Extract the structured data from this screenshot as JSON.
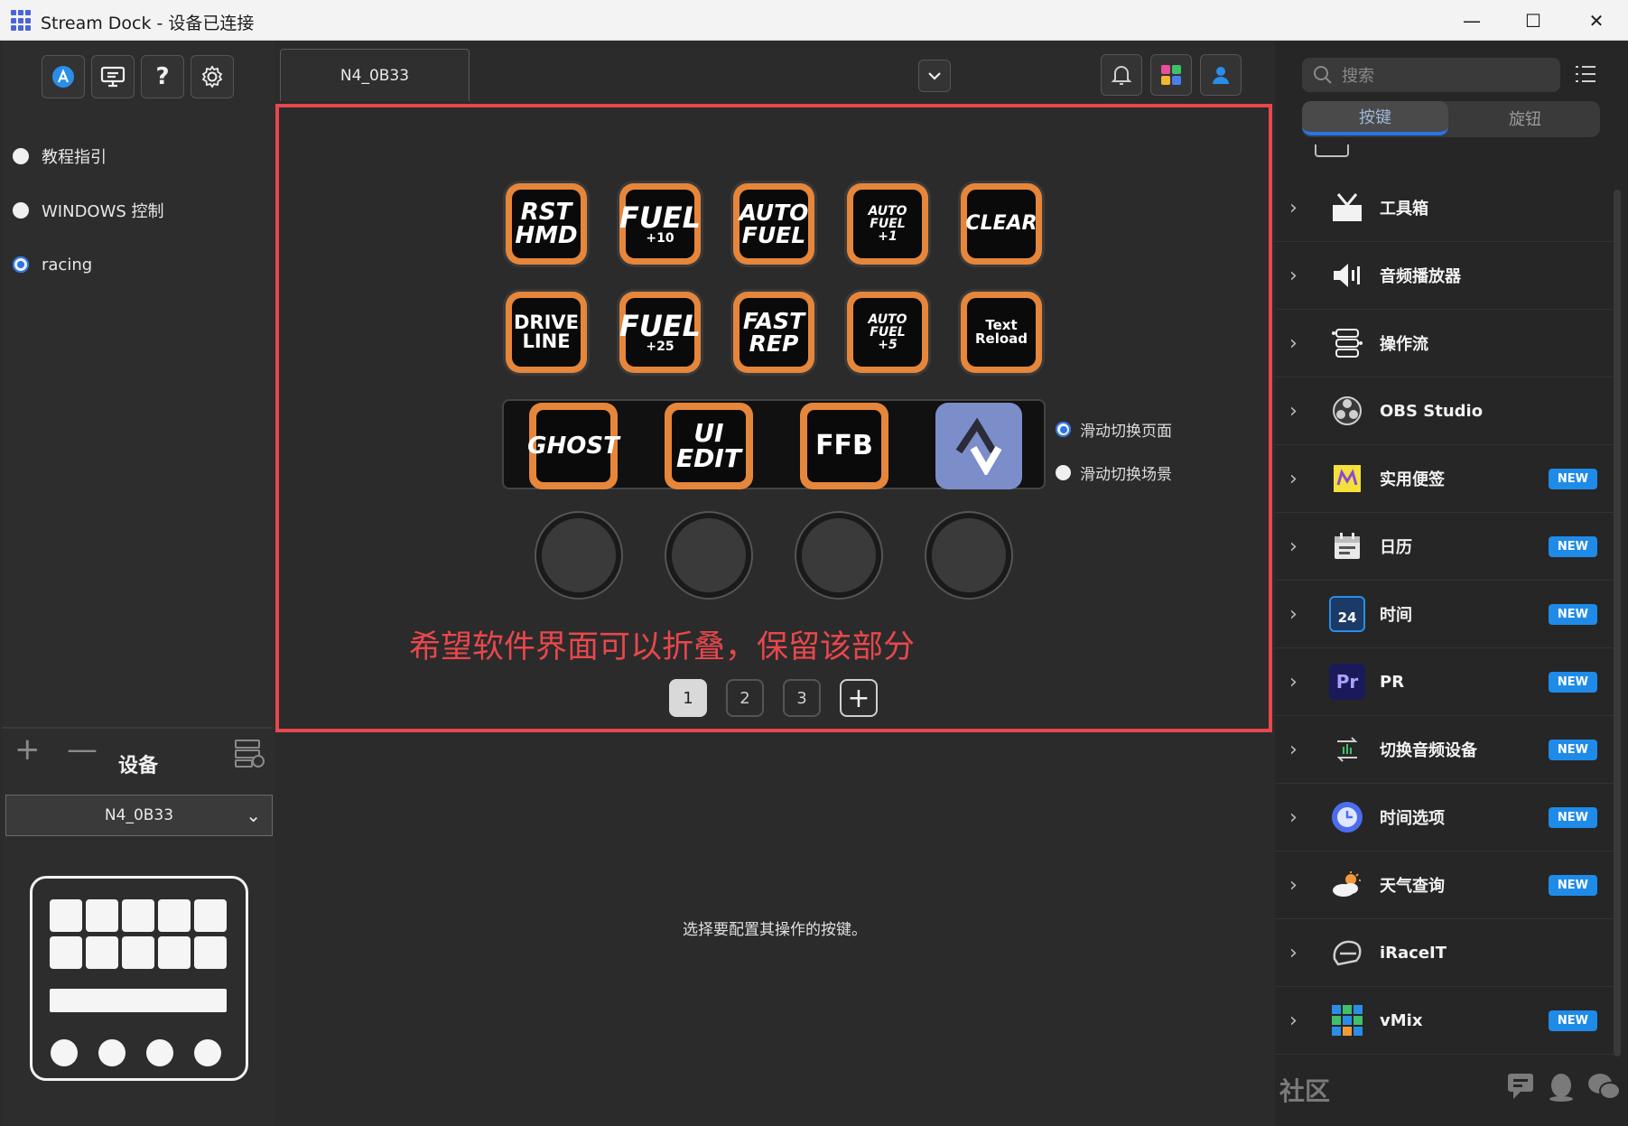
{
  "window": {
    "title": "Stream Dock - 设备已连接",
    "minimize": "—",
    "maximize": "☐",
    "close": "✕"
  },
  "sidebar": {
    "profiles": [
      {
        "label": "教程指引",
        "selected": false
      },
      {
        "label": "WINDOWS 控制",
        "selected": false
      },
      {
        "label": "racing",
        "selected": true
      }
    ],
    "add": "+",
    "remove": "—",
    "device_heading": "设备",
    "device_selected": "N4_0B33"
  },
  "center": {
    "device_tab": "N4_0B33",
    "keys_row1": [
      {
        "line1": "RST",
        "line2": "HMD",
        "line3": ""
      },
      {
        "line1": "FUEL",
        "line2": "",
        "line3": "+10"
      },
      {
        "line1": "AUTO",
        "line2": "FUEL",
        "line3": ""
      },
      {
        "line1": "AUTO",
        "line2": "FUEL",
        "line3": "+1"
      },
      {
        "line1": "CLEAR",
        "line2": "",
        "line3": ""
      }
    ],
    "keys_row2": [
      {
        "line1": "DRIVE",
        "line2": "LINE",
        "line3": ""
      },
      {
        "line1": "FUEL",
        "line2": "",
        "line3": "+25"
      },
      {
        "line1": "FAST",
        "line2": "REP",
        "line3": ""
      },
      {
        "line1": "AUTO",
        "line2": "FUEL",
        "line3": "+5"
      },
      {
        "line1": "Text",
        "line2": "Reload",
        "line3": ""
      }
    ],
    "strip_keys": [
      {
        "line1": "GHOST",
        "line2": ""
      },
      {
        "line1": "UI",
        "line2": "EDIT"
      },
      {
        "line1": "FFB",
        "line2": ""
      }
    ],
    "slide_options": [
      {
        "label": "滑动切换页面",
        "selected": true
      },
      {
        "label": "滑动切换场景",
        "selected": false
      }
    ],
    "annotation": "希望软件界面可以折叠，保留该部分",
    "pages": [
      "1",
      "2",
      "3"
    ],
    "add_page": "+",
    "hint": "选择要配置其操作的按键。"
  },
  "right": {
    "search_placeholder": "搜索",
    "tabs": [
      "按键",
      "旋钮"
    ],
    "categories": [
      {
        "label": "工具箱",
        "icon": "toolbox-icon",
        "new": false
      },
      {
        "label": "音频播放器",
        "icon": "speaker-icon",
        "new": false
      },
      {
        "label": "操作流",
        "icon": "flow-icon",
        "new": false
      },
      {
        "label": "OBS Studio",
        "icon": "obs-icon",
        "new": false
      },
      {
        "label": "实用便签",
        "icon": "sticky-note-icon",
        "new": true
      },
      {
        "label": "日历",
        "icon": "calendar-icon",
        "new": true
      },
      {
        "label": "时间",
        "icon": "time-icon",
        "new": true
      },
      {
        "label": "PR",
        "icon": "premiere-icon",
        "new": true
      },
      {
        "label": "切换音频设备",
        "icon": "audio-switch-icon",
        "new": true
      },
      {
        "label": "时间选项",
        "icon": "clock-icon",
        "new": true
      },
      {
        "label": "天气查询",
        "icon": "weather-icon",
        "new": true
      },
      {
        "label": "iRaceIT",
        "icon": "helmet-icon",
        "new": false
      },
      {
        "label": "vMix",
        "icon": "vmix-icon",
        "new": true
      }
    ],
    "badge": "NEW",
    "time_icon_text": "24",
    "pr_icon_text": "Pr",
    "community": "社区"
  },
  "colors": {
    "accent": "#2a74e5",
    "key_border": "#e6863a",
    "annotation": "#e8474c",
    "badge": "#1f8be8"
  }
}
